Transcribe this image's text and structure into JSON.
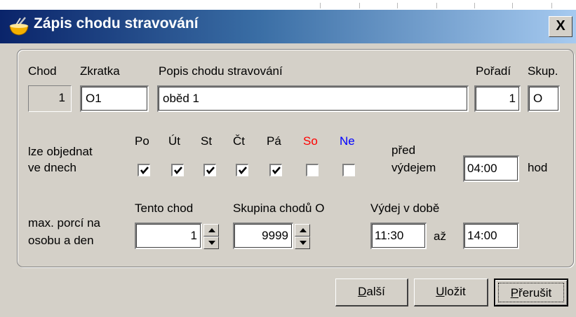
{
  "window": {
    "title": "Zápis chodu stravování",
    "close_label": "X"
  },
  "header": {
    "chod": "Chod",
    "zkratka": "Zkratka",
    "popis": "Popis chodu stravování",
    "poradi": "Pořadí",
    "skup": "Skup."
  },
  "values": {
    "chod": "1",
    "zkratka": "O1",
    "popis": "oběd 1",
    "poradi": "1",
    "skup": "O"
  },
  "days": {
    "label_line1": "lze objednat",
    "label_line2": "ve dnech",
    "items": [
      {
        "label": "Po",
        "checked": true,
        "color": "#000000"
      },
      {
        "label": "Út",
        "checked": true,
        "color": "#000000"
      },
      {
        "label": "St",
        "checked": true,
        "color": "#000000"
      },
      {
        "label": "Čt",
        "checked": true,
        "color": "#000000"
      },
      {
        "label": "Pá",
        "checked": true,
        "color": "#000000"
      },
      {
        "label": "So",
        "checked": false,
        "color": "#ff0000"
      },
      {
        "label": "Ne",
        "checked": false,
        "color": "#0000ff"
      }
    ]
  },
  "pred": {
    "line1": "před",
    "line2": "výdejem",
    "value": "04:00",
    "unit": "hod"
  },
  "limits": {
    "label_line1": "max. porcí na",
    "label_line2": "osobu a den",
    "tento_chod_label": "Tento chod",
    "tento_chod_value": "1",
    "skupina_label": "Skupina chodů O",
    "skupina_value": "9999"
  },
  "vydej": {
    "label": "Výdej v době",
    "from": "11:30",
    "sep": "až",
    "to": "14:00"
  },
  "buttons": {
    "dalsi_u": "D",
    "dalsi_rest": "alší",
    "ulozit_u": "U",
    "ulozit_rest": "ložit",
    "prerusit_u": "P",
    "prerusit_rest": "řerušit"
  },
  "icons": {
    "title": "bowl-icon",
    "close": "close-icon",
    "check": "checkmark-icon",
    "spin_up": "spin-up-icon",
    "spin_down": "spin-down-icon"
  }
}
